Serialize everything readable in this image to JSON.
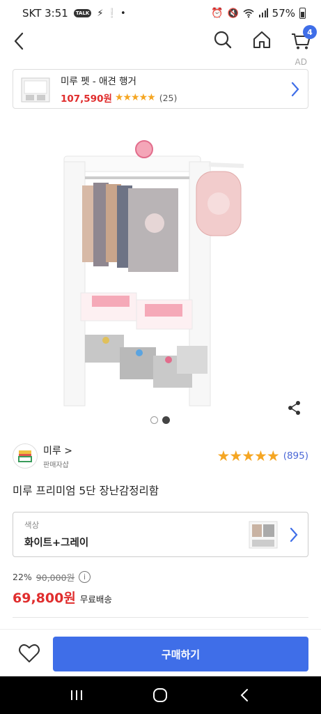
{
  "status_bar": {
    "carrier_time": "SKT 3:51",
    "talk_badge": "TALK",
    "battery": "57%"
  },
  "nav": {
    "cart_count": "4",
    "ad_label": "AD"
  },
  "ad_banner": {
    "title": "미루 펫 - 애견 행거",
    "price": "107,590원",
    "stars": "★★★★★",
    "review_count": "(25)"
  },
  "product": {
    "seller_name": "미루 >",
    "seller_sub": "판매자샵",
    "rating_stars": "★★★★★",
    "rating_count": "(895)",
    "title": "미루 프리미엄 5단 장난감정리함",
    "image_pager": {
      "total": 2,
      "active": 2
    }
  },
  "option": {
    "label": "색상",
    "value": "화이트+그레이"
  },
  "price": {
    "discount": "22%",
    "original": "90,000원",
    "info": "i",
    "final": "69,800원",
    "shipping": "무료배송"
  },
  "bottom": {
    "buy_label": "구매하기"
  },
  "colors": {
    "accent": "#3f6ee8",
    "price_red": "#e02d2d",
    "star": "#f5a623"
  }
}
